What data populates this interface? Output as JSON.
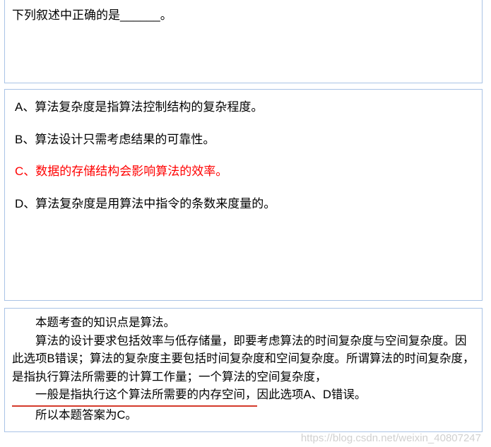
{
  "question": {
    "stem_prefix": "下列叙述中正确的是",
    "blank": "______",
    "stem_suffix": "。"
  },
  "options": [
    {
      "label": "A、",
      "text": "算法复杂度是指算法控制结构的复杂程度。",
      "correct": false
    },
    {
      "label": "B、",
      "text": "算法设计只需考虑结果的可靠性。",
      "correct": false
    },
    {
      "label": "C、",
      "text": "数据的存储结构会影响算法的效率。",
      "correct": true
    },
    {
      "label": "D、",
      "text": "算法复杂度是用算法中指令的条数来度量的。",
      "correct": false
    }
  ],
  "explanation": {
    "p1": "本题考查的知识点是算法。",
    "p2_a": "算法的设计要求包括效率与低存储量，即要考虑算法的时间复杂度与空间复杂度。因此选项B错误；算法的复杂度主要包括时间复杂度和空间复杂度。所谓算法的时间复杂度，是指执行算法所需要的计算工作量；一个算法的空间复杂度，",
    "p2_underlined": "一般是指执行这个算法所需要的内存空间，",
    "p2_b": "因此选项A、D错误。",
    "p3": "所以本题答案为C。"
  },
  "watermark": "https://blog.csdn.net/weixin_40807247"
}
